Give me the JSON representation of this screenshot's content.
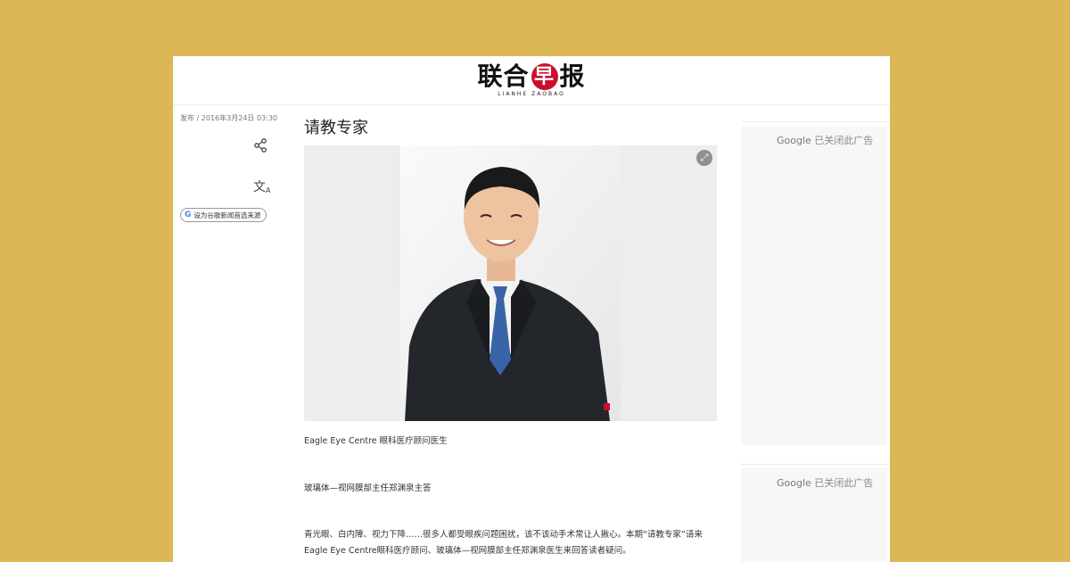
{
  "header": {
    "logo_cn_1": "联合",
    "logo_seal": "早",
    "logo_cn_2": "报",
    "logo_en": "LIANHE ZAOBAO"
  },
  "sidebar": {
    "publish_meta": "发布 / 2016年3月24日 03:30",
    "share_icon": "share-icon",
    "translate_glyph": "文",
    "translate_sub": "A",
    "google_source_button": "设为谷歌新闻首选来源"
  },
  "article": {
    "title": "请教专家",
    "caption": "Eagle Eye Centre 眼科医疗顾问医生",
    "para1": "玻璃体—视网膜部主任郑渊泉主答",
    "para2": "青光眼、白内障、视力下降……很多人都受眼疾问题困扰，该不该动手术常让人揪心。本期“请教专家”请来Eagle Eye Centre眼科医疗顾问、玻璃体—视网膜部主任郑渊泉医生来回答读者疑问。"
  },
  "ads": [
    {
      "brand": "Google",
      "text": "已关闭此广告"
    },
    {
      "brand": "Google",
      "text": "已关闭此广告"
    }
  ],
  "colors": {
    "background": "#dbb855",
    "logo_red": "#c8102e",
    "suit": "#23262b",
    "tie": "#3a64a8"
  }
}
